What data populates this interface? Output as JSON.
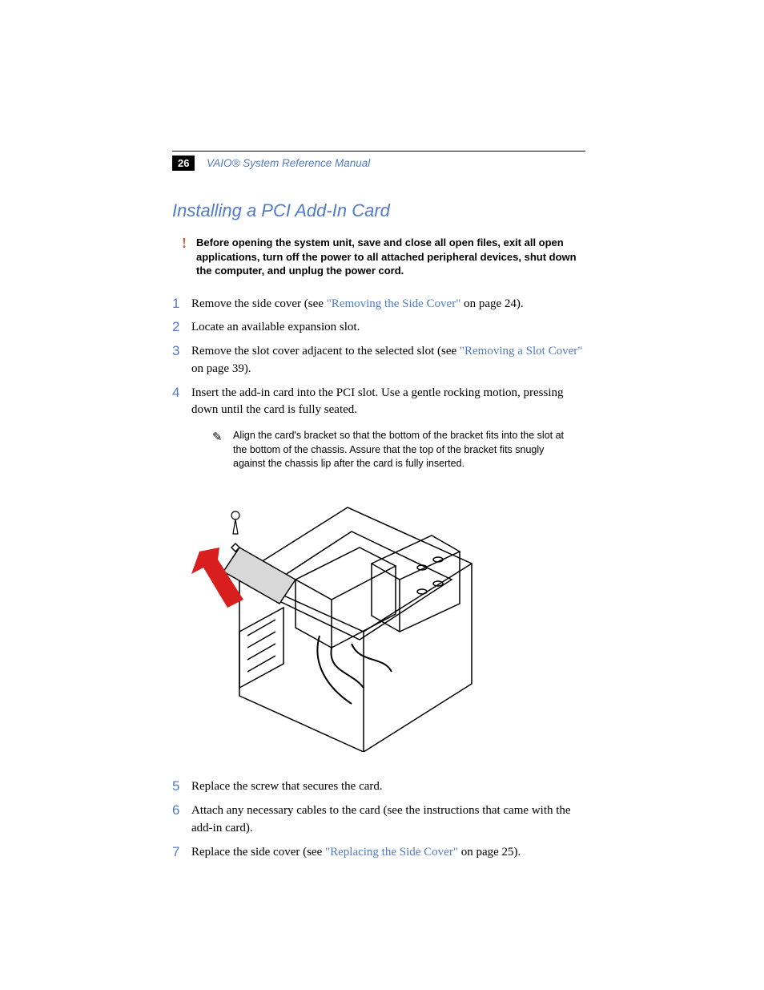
{
  "header": {
    "page_number": "26",
    "running_title": "VAIO® System Reference Manual"
  },
  "section_title": "Installing a PCI Add-In Card",
  "warning": {
    "text": "Before opening the system unit, save and close all open files, exit all open applications, turn off the power to all attached peripheral devices, shut down the computer, and unplug the power cord."
  },
  "steps": [
    {
      "num": "1",
      "pre": "Remove the side cover (see ",
      "link": "\"Removing the Side Cover\"",
      "post": " on page 24)."
    },
    {
      "num": "2",
      "pre": "Locate an available expansion slot.",
      "link": "",
      "post": ""
    },
    {
      "num": "3",
      "pre": "Remove the slot cover adjacent to the selected slot (see ",
      "link": "\"Removing a Slot Cover\"",
      "post": " on page 39)."
    },
    {
      "num": "4",
      "pre": "Insert the add-in card into the PCI slot. Use a gentle rocking motion, pressing down until the card is fully seated.",
      "link": "",
      "post": ""
    },
    {
      "num": "5",
      "pre": "Replace the screw that secures the card.",
      "link": "",
      "post": ""
    },
    {
      "num": "6",
      "pre": "Attach any necessary cables to the card (see the instructions that came with the add-in card).",
      "link": "",
      "post": ""
    },
    {
      "num": "7",
      "pre": "Replace the side cover (see ",
      "link": "\"Replacing the Side Cover\"",
      "post": " on page 25)."
    }
  ],
  "note": {
    "text": "Align the card's bracket so that the bottom of the bracket fits into the slot at the bottom of the chassis. Assure that the top of the bracket fits snugly against the chassis lip after the card is fully inserted."
  },
  "icons": {
    "warning": "!",
    "note": "✎"
  }
}
